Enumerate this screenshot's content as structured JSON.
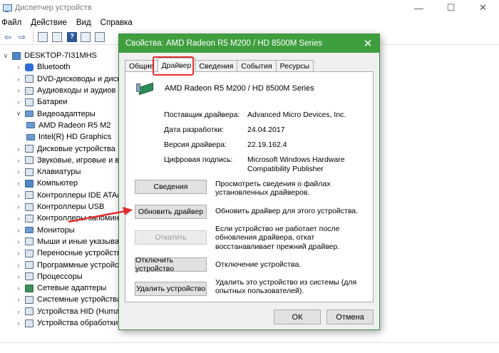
{
  "window": {
    "title": "Диспетчер устройств",
    "controls": [
      "—",
      "☐",
      "✕"
    ]
  },
  "menu": [
    "Файл",
    "Действие",
    "Вид",
    "Справка"
  ],
  "tree": {
    "root": "DESKTOP-7I31MHS",
    "items": [
      {
        "label": "Bluetooth",
        "icon": "bluetooth-icon"
      },
      {
        "label": "DVD-дисководы и диск",
        "icon": "dvd-icon"
      },
      {
        "label": "Аудиовходы и аудиов",
        "icon": "audio-icon"
      },
      {
        "label": "Батареи",
        "icon": "battery-icon"
      },
      {
        "label": "Видеоадаптеры",
        "icon": "display-adapter-icon",
        "expanded": true
      },
      {
        "label": "AMD Radeon R5 M2",
        "icon": "display-icon",
        "child": true
      },
      {
        "label": "Intel(R) HD Graphics",
        "icon": "display-icon",
        "child": true
      },
      {
        "label": "Дисковые устройства",
        "icon": "disk-icon"
      },
      {
        "label": "Звуковые, игровые и в",
        "icon": "sound-icon"
      },
      {
        "label": "Клавиатуры",
        "icon": "keyboard-icon"
      },
      {
        "label": "Компьютер",
        "icon": "computer-icon"
      },
      {
        "label": "Контроллеры IDE ATA/",
        "icon": "ide-icon"
      },
      {
        "label": "Контроллеры USB",
        "icon": "usb-icon"
      },
      {
        "label": "Контроллеры запомин",
        "icon": "storage-icon"
      },
      {
        "label": "Мониторы",
        "icon": "monitor-icon"
      },
      {
        "label": "Мыши и иные указыва",
        "icon": "mouse-icon"
      },
      {
        "label": "Переносные устройств",
        "icon": "portable-icon"
      },
      {
        "label": "Программные устройств",
        "icon": "software-icon"
      },
      {
        "label": "Процессоры",
        "icon": "cpu-icon"
      },
      {
        "label": "Сетевые адаптеры",
        "icon": "network-icon"
      },
      {
        "label": "Системные устройства",
        "icon": "system-icon"
      },
      {
        "label": "Устройства HID (Huma",
        "icon": "hid-icon"
      },
      {
        "label": "Устройства обработки",
        "icon": "imaging-icon"
      }
    ]
  },
  "dialog": {
    "title": "Свойства: AMD Radeon R5 M200 / HD 8500M Series",
    "tabs": [
      "Общие",
      "Драйвер",
      "Сведения",
      "События",
      "Ресурсы"
    ],
    "active_tab": "Драйвер",
    "device_name": "AMD Radeon R5 M200 / HD 8500M Series",
    "props": [
      {
        "label": "Поставщик драйвера:",
        "value": "Advanced Micro Devices, Inc."
      },
      {
        "label": "Дата разработки:",
        "value": "24.04.2017"
      },
      {
        "label": "Версия драйвера:",
        "value": "22.19.162.4"
      },
      {
        "label": "Цифровая подпись:",
        "value": "Microsoft Windows Hardware Compatibility Publisher"
      }
    ],
    "actions": [
      {
        "button": "Сведения",
        "desc": "Просмотреть сведения о файлах установленных драйверов.",
        "enabled": true
      },
      {
        "button": "Обновить драйвер",
        "desc": "Обновить драйвер для этого устройства.",
        "enabled": true
      },
      {
        "button": "Откатить",
        "desc": "Если устройство не работает после обновления драйвера, откат восстанавливает прежний драйвер.",
        "enabled": false
      },
      {
        "button": "Отключить устройство",
        "desc": "Отключение устройства.",
        "enabled": true
      },
      {
        "button": "Удалить устройство",
        "desc": "Удалить это устройство из системы (для опытных пользователей).",
        "enabled": true
      }
    ],
    "ok": "ОК",
    "cancel": "Отмена"
  },
  "colors": {
    "dialog_title_bg": "#3f9f3f",
    "highlight": "#e03030",
    "arrow": "#e03030"
  }
}
